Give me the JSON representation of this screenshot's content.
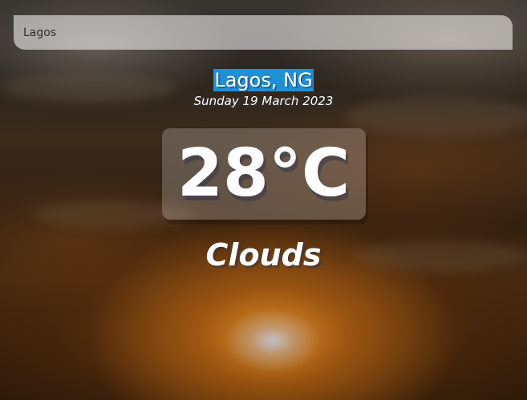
{
  "search": {
    "value": "Lagos"
  },
  "location": {
    "name": "Lagos, NG",
    "date": "Sunday 19 March 2023"
  },
  "weather": {
    "temperature": "28°C",
    "condition": "Clouds"
  },
  "colors": {
    "location_highlight": "#1f8fd6",
    "text": "#ffffff"
  }
}
